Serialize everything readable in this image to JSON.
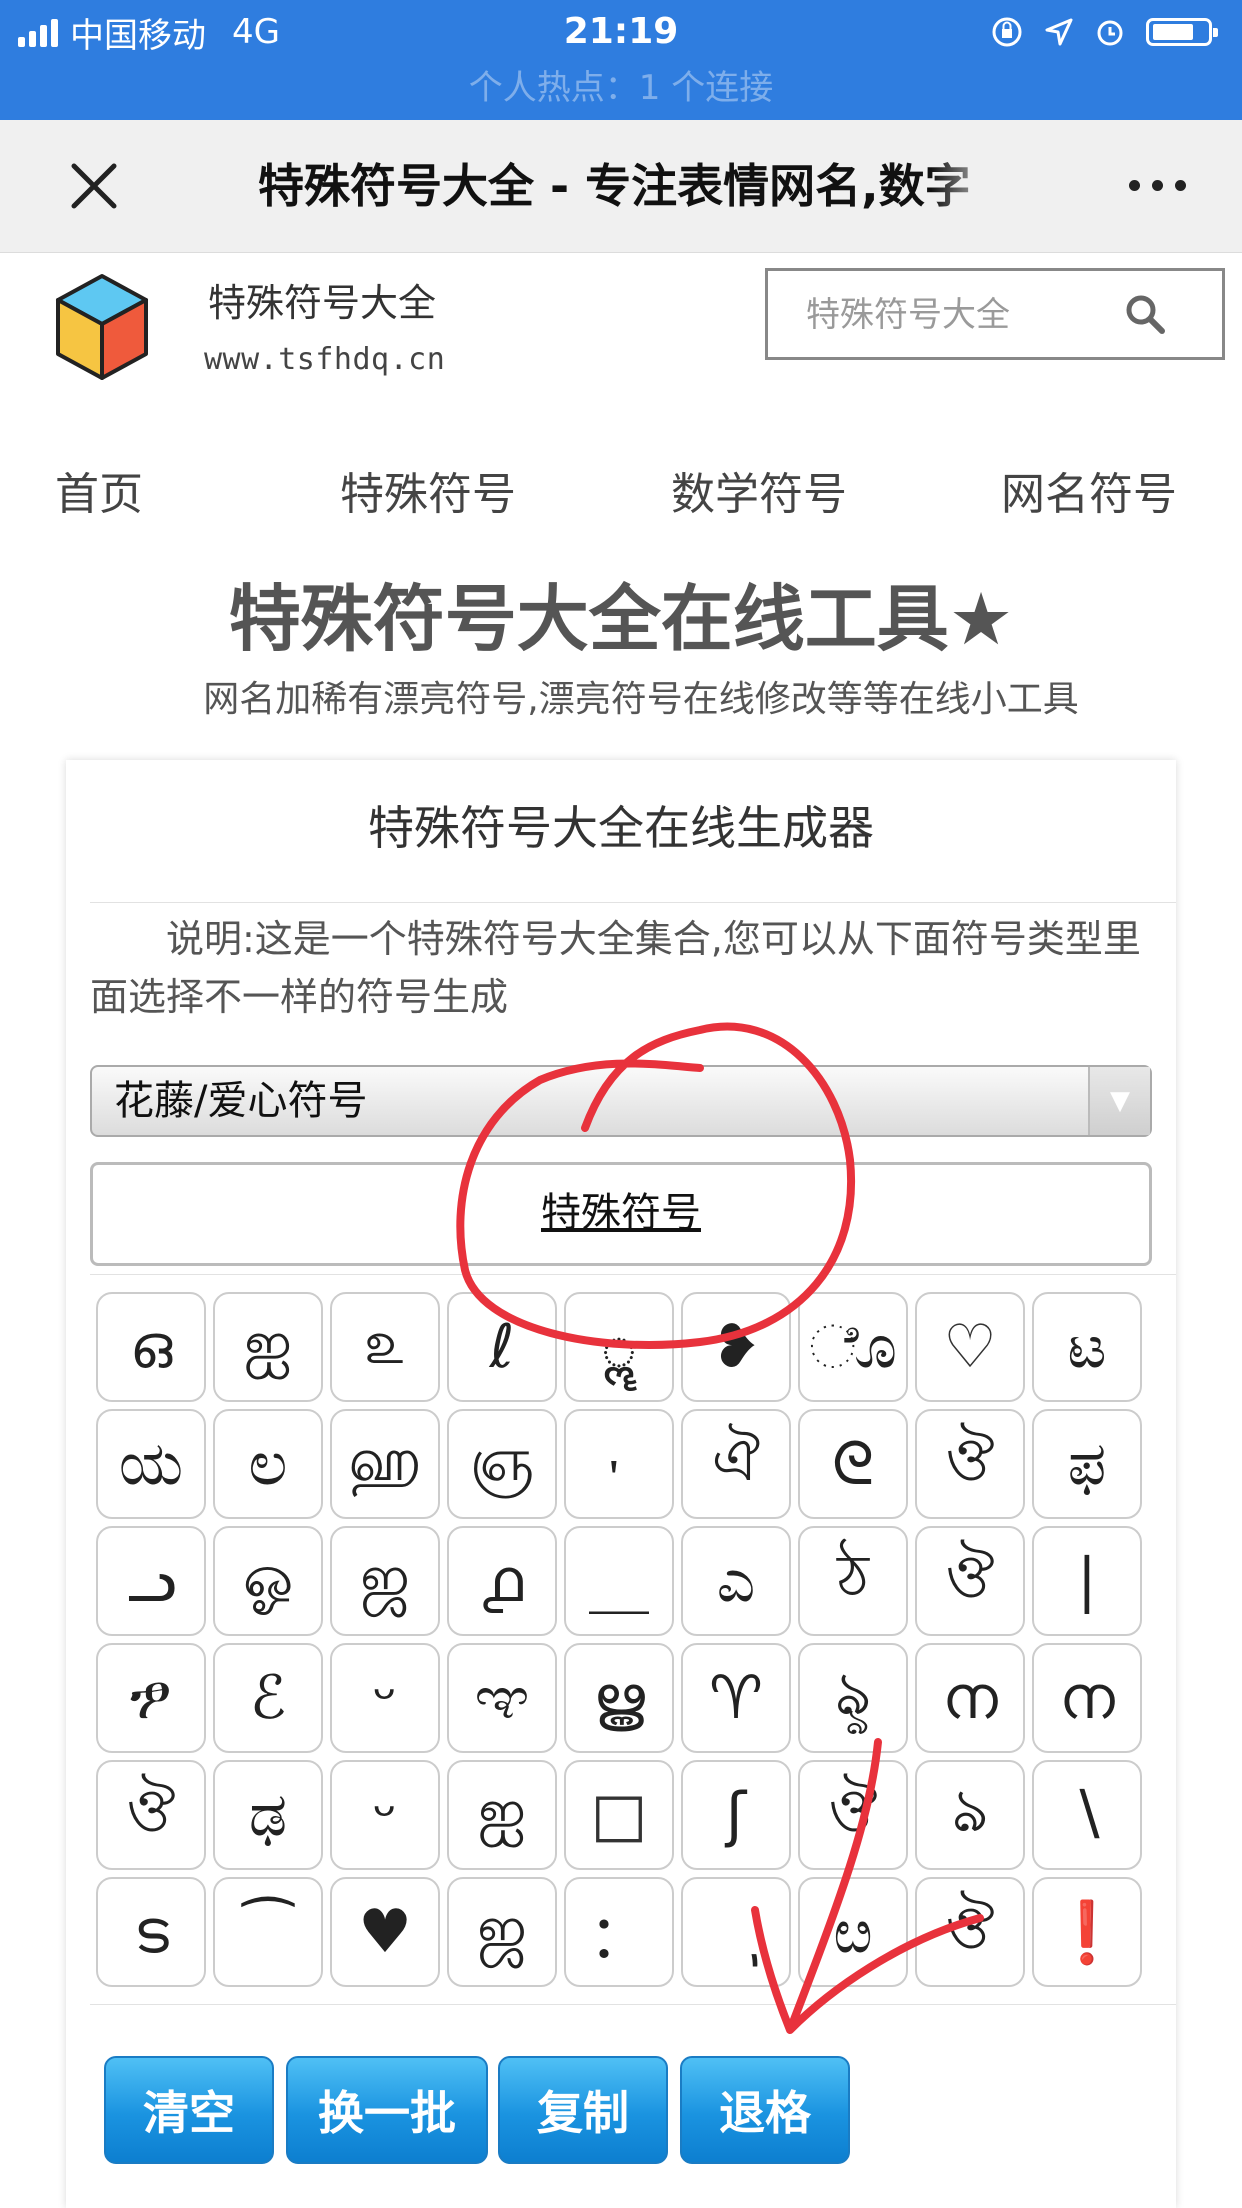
{
  "status_bar": {
    "carrier": "中国移动",
    "network": "4G",
    "time": "21:19",
    "hotspot": "个人热点：1 个连接"
  },
  "webview": {
    "title": "特殊符号大全 - 专注表情网名,数字"
  },
  "site": {
    "name": "特殊符号大全",
    "url": "www.tsfhdq.cn",
    "search_placeholder": "特殊符号大全"
  },
  "nav": [
    "首页",
    "特殊符号",
    "数学符号",
    "网名符号"
  ],
  "page": {
    "title": "特殊符号大全在线工具★",
    "subtitle": "网名加稀有漂亮符号,漂亮符号在线修改等等在线小工具"
  },
  "generator": {
    "title": "特殊符号大全在线生成器",
    "description": "说明:这是一个特殊符号大全集合,您可以从下面符号类型里面选择不一样的符号生成",
    "selected_category": "花藤/爱心符号",
    "output_text": "特殊符号",
    "symbols": [
      "ഒ",
      "ஐ",
      "௨",
      "ℓ",
      "ॣ",
      "❥",
      "ೊ",
      "♡",
      "ಟ",
      "ಯ",
      "ಲ",
      "ஹ",
      "ஞ",
      "ᡃ",
      "ঐ",
      "ᘓ",
      "ঔ",
      "ಫ",
      "ᓗ",
      "ஓ",
      "ஜ",
      "൧",
      "＿",
      "ಎ",
      "ঠ",
      "ঔ",
      "∣",
      "ፇ",
      "ℰ",
      "ᵕ",
      "ಞ",
      "ൠ",
      "♈",
      "ৡ",
      "ന",
      "ന",
      "ঔ",
      "ಢ",
      "ᵕ",
      "ஐ",
      "□",
      "ʃ",
      "ঔ",
      "ঌ",
      "∖",
      "ട",
      "⁀",
      "♥",
      "ஜ",
      "：",
      "ٖ",
      "ೞ",
      "ঔ",
      "❗"
    ],
    "buttons": {
      "clear": "清空",
      "shuffle": "换一批",
      "copy": "复制",
      "backspace": "退格"
    }
  },
  "colors": {
    "status_bar": "#2f7ddf",
    "button": "#1a93e0",
    "annotation": "#e8323c"
  }
}
